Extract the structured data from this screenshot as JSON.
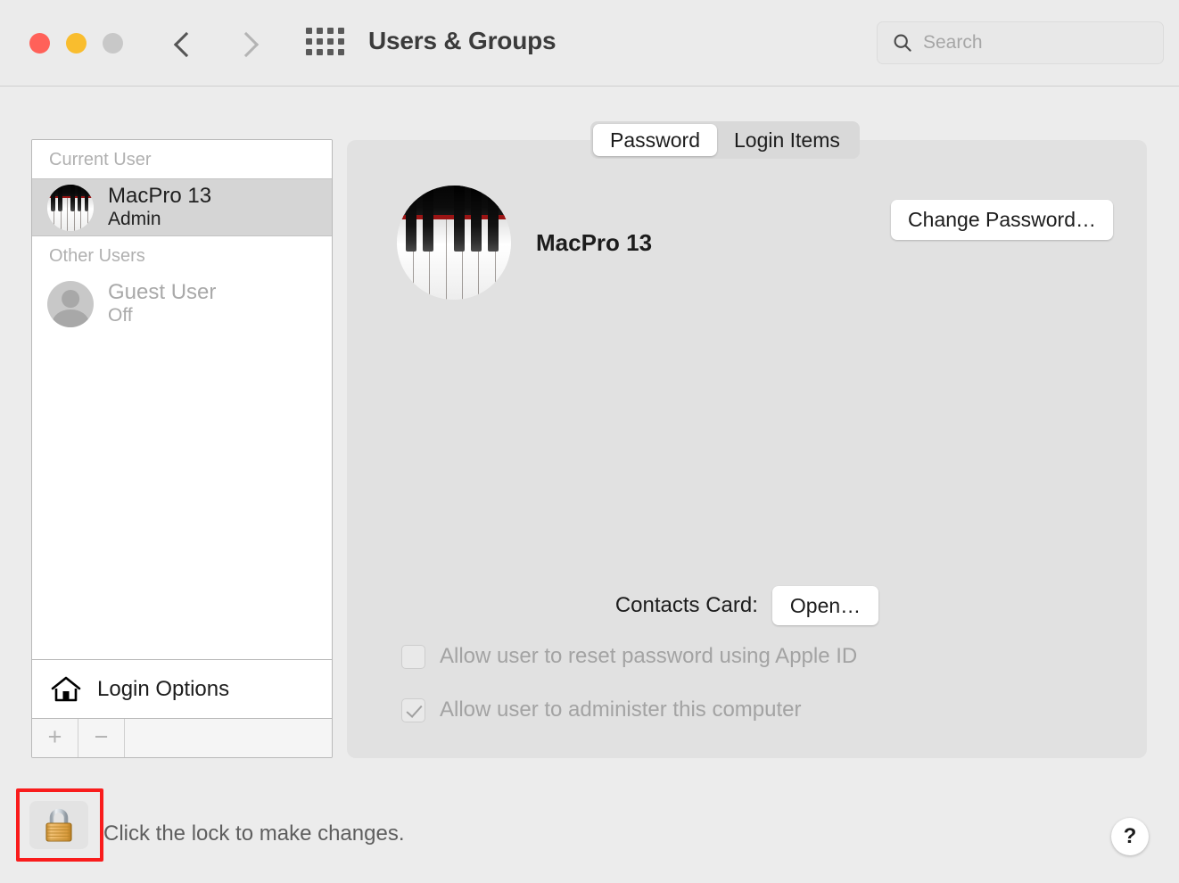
{
  "window": {
    "title": "Users & Groups",
    "traffic_lights": {
      "close_color": "#ff6159",
      "minimize_color": "#f9bd2e",
      "zoom_color": "#c8c8c8"
    },
    "nav": {
      "back_label": "‹",
      "forward_label": "›"
    },
    "grid_button_label": "Show All"
  },
  "search": {
    "placeholder": "Search",
    "value": ""
  },
  "sidebar": {
    "groups": [
      {
        "header": "Current User",
        "users": [
          {
            "name": "MacPro 13",
            "role": "Admin",
            "avatar": "piano-avatar",
            "selected": true,
            "dimmed": false
          }
        ]
      },
      {
        "header": "Other Users",
        "users": [
          {
            "name": "Guest User",
            "role": "Off",
            "avatar": "person-avatar",
            "selected": false,
            "dimmed": true
          }
        ]
      }
    ],
    "login_options_label": "Login Options",
    "login_options_icon": "house-icon",
    "toolbar": {
      "add_label": "+",
      "remove_label": "−"
    }
  },
  "main": {
    "tabs": [
      {
        "label": "Password",
        "active": true
      },
      {
        "label": "Login Items",
        "active": false
      }
    ],
    "profile": {
      "name": "MacPro 13",
      "avatar": "piano-avatar"
    },
    "change_password_label": "Change Password…",
    "contacts_card_label": "Contacts Card:",
    "contacts_open_label": "Open…",
    "checkboxes": [
      {
        "label": "Allow user to reset password using Apple ID",
        "checked": false,
        "disabled": true
      },
      {
        "label": "Allow user to administer this computer",
        "checked": true,
        "disabled": true
      }
    ]
  },
  "footer": {
    "lock_icon": "closed-padlock-icon",
    "lock_message": "Click the lock to make changes.",
    "help_label": "?",
    "highlight_color": "#f91c1c"
  }
}
